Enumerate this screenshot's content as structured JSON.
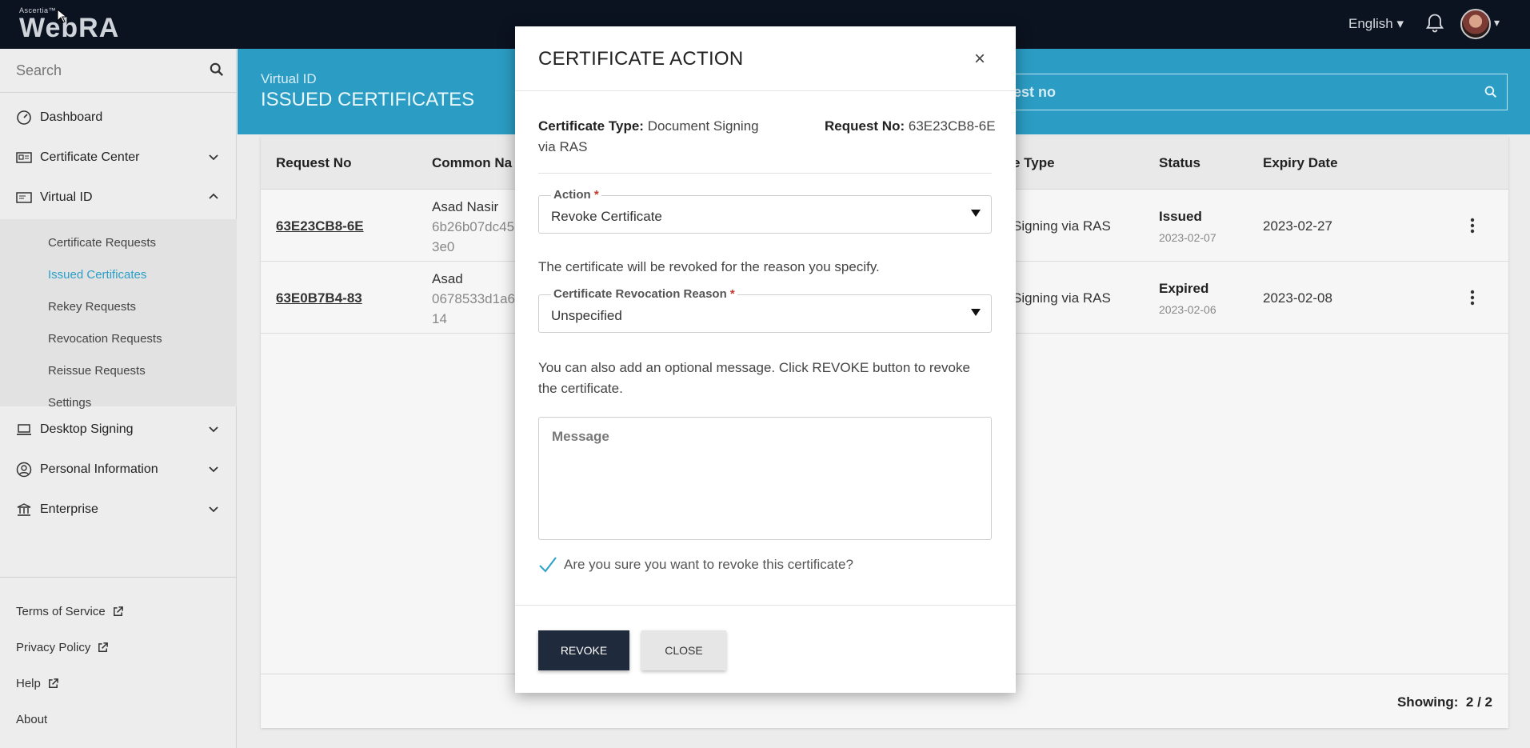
{
  "topbar": {
    "logo_small": "Ascertia™",
    "logo_big": "WebRA",
    "language": "English ▾",
    "caret": "▾"
  },
  "sidebar": {
    "search_placeholder": "Search",
    "items": [
      {
        "label": "Dashboard"
      },
      {
        "label": "Certificate Center"
      },
      {
        "label": "Virtual ID"
      },
      {
        "label": "Desktop Signing"
      },
      {
        "label": "Personal Information"
      },
      {
        "label": "Enterprise"
      }
    ],
    "sub_items": [
      {
        "label": "Certificate Requests"
      },
      {
        "label": "Issued Certificates"
      },
      {
        "label": "Rekey Requests"
      },
      {
        "label": "Revocation Requests"
      },
      {
        "label": "Reissue Requests"
      },
      {
        "label": "Settings"
      }
    ],
    "footer": [
      {
        "label": "Terms of Service"
      },
      {
        "label": "Privacy Policy"
      },
      {
        "label": "Help"
      },
      {
        "label": "About"
      }
    ]
  },
  "main": {
    "breadcrumb": "Virtual ID",
    "title": "ISSUED CERTIFICATES",
    "search_fragment": "est no",
    "columns": [
      "Request No",
      "Common Na",
      "e Type",
      "Status",
      "Expiry Date"
    ],
    "rows": [
      {
        "request_no": "63E23CB8-6E",
        "cn_name": "Asad Nasir",
        "cn_line2": "6b26b07dc45",
        "cn_line3": "3e0",
        "type": "Signing via RAS",
        "status": "Issued",
        "status_date": "2023-02-07",
        "expiry": "2023-02-27"
      },
      {
        "request_no": "63E0B7B4-83",
        "cn_name": "Asad",
        "cn_line2": "0678533d1a6",
        "cn_line3": "14",
        "type": "Signing via RAS",
        "status": "Expired",
        "status_date": "2023-02-06",
        "expiry": "2023-02-08"
      }
    ],
    "showing_label": "Showing:",
    "showing_value": "2 / 2"
  },
  "modal": {
    "title": "CERTIFICATE ACTION",
    "close_symbol": "×",
    "cert_type_label": "Certificate Type:",
    "cert_type_value": "Document Signing",
    "cert_type_value2": "via RAS",
    "request_no_label": "Request No:",
    "request_no_value": "63E23CB8-6E",
    "action_label": "Action",
    "required_mark": "*",
    "action_value": "Revoke Certificate",
    "revoke_note": "The certificate will be revoked for the reason you specify.",
    "reason_label": "Certificate Revocation Reason",
    "reason_value": "Unspecified",
    "message_note": "You can also add an optional message. Click REVOKE button to revoke the certificate.",
    "message_placeholder": "Message",
    "confirm_text": "Are you sure you want to revoke this certificate?",
    "revoke_button": "REVOKE",
    "close_button": "CLOSE"
  },
  "colors": {
    "topbar": "#0b1220",
    "header": "#2b9cc3",
    "active_link": "#2a9fc9",
    "revoke_button": "#1f2a3d"
  }
}
